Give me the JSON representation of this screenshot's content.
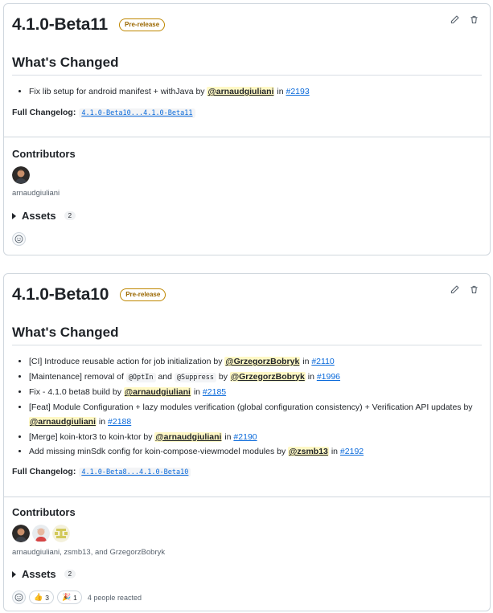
{
  "releases": [
    {
      "title": "4.1.0-Beta11",
      "badge": "Pre-release",
      "heading": "What's Changed",
      "changes": [
        {
          "text": "Fix lib setup for android manifest + withJava by ",
          "mention": "@arnaudgiuliani",
          "in": " in ",
          "issue": "#2193"
        }
      ],
      "changelog_label": "Full Changelog:",
      "changelog_link": "4.1.0-Beta10...4.1.0-Beta11",
      "contributors_label": "Contributors",
      "contributor_names": "arnaudgiuliani",
      "assets_label": "Assets",
      "assets_count": "2"
    },
    {
      "title": "4.1.0-Beta10",
      "badge": "Pre-release",
      "heading": "What's Changed",
      "changes": [
        {
          "text": "[CI] Introduce reusable action for job initialization by ",
          "mention": "@GrzegorzBobryk",
          "in": " in ",
          "issue": "#2110"
        },
        {
          "text_a": "[Maintenance] removal of ",
          "code_a": "@OptIn",
          "text_b": " and ",
          "code_b": "@Suppress",
          "text_c": " by ",
          "mention": "@GrzegorzBobryk",
          "in": " in ",
          "issue": "#1996"
        },
        {
          "text": "Fix - 4.1.0 beta8 build by ",
          "mention": "@arnaudgiuliani",
          "in": " in ",
          "issue": "#2185"
        },
        {
          "text": "[Feat] Module Configuration + lazy modules verification (global configuration consistency) + Verification API updates by ",
          "mention": "@arnaudgiuliani",
          "in": " in ",
          "issue": "#2188"
        },
        {
          "text": "[Merge] koin-ktor3 to koin-ktor by ",
          "mention": "@arnaudgiuliani",
          "in": " in ",
          "issue": "#2190"
        },
        {
          "text": "Add missing minSdk config for koin-compose-viewmodel modules by ",
          "mention": "@zsmb13",
          "in": " in ",
          "issue": "#2192"
        }
      ],
      "changelog_label": "Full Changelog:",
      "changelog_link": "4.1.0-Beta8...4.1.0-Beta10",
      "contributors_label": "Contributors",
      "contributor_names": "arnaudgiuliani, zsmb13, and GrzegorzBobryk",
      "assets_label": "Assets",
      "assets_count": "2",
      "reactions": [
        {
          "emoji": "👍",
          "count": "3"
        },
        {
          "emoji": "🎉",
          "count": "1"
        }
      ],
      "reacted_text": "4 people reacted"
    }
  ],
  "icons": {
    "edit": "pencil-icon",
    "delete": "trash-icon",
    "smiley": "smiley-icon"
  },
  "colors": {
    "link": "#0969da",
    "mention_bg": "#fff8c5",
    "badge": "#9a6700",
    "border": "#d0d7de"
  }
}
